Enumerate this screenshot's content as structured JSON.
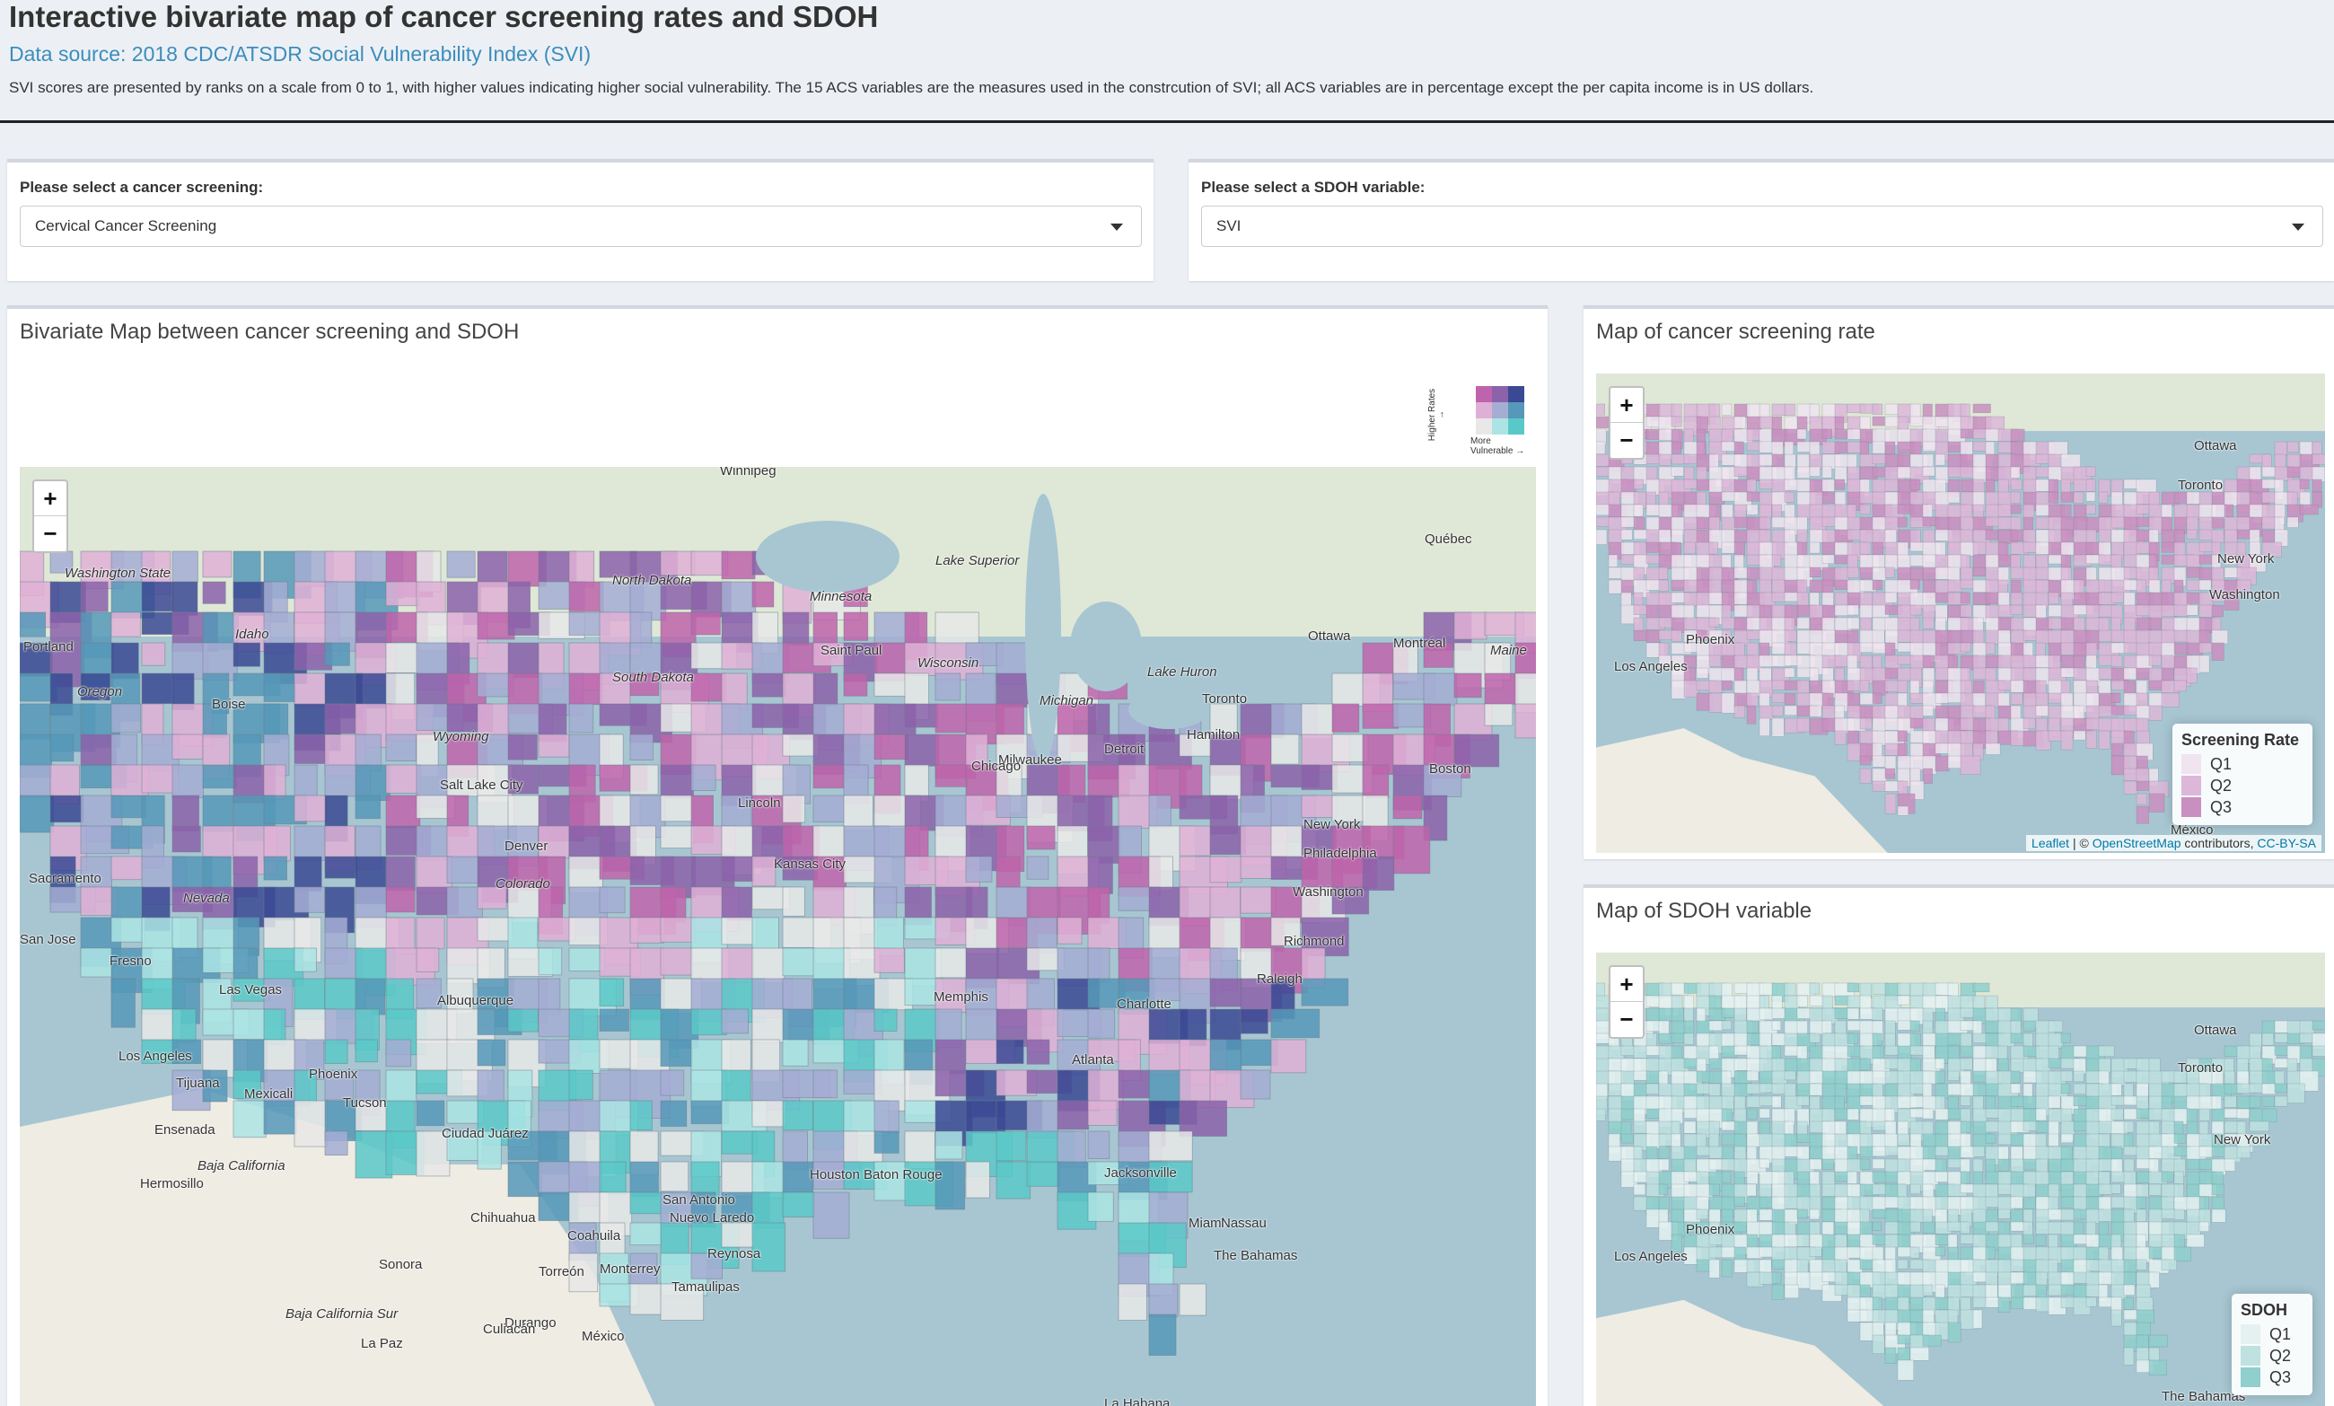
{
  "header": {
    "title": "Interactive bivariate map of cancer screening rates and SDOH",
    "source": "Data source: 2018 CDC/ATSDR Social Vulnerability Index (SVI)",
    "description": "SVI scores are presented by ranks on a scale from 0 to 1, with higher values indicating higher social vulnerability. The 15 ACS variables are the measures used in the constrcution of SVI; all ACS variables are in percentage except the per capita income is in US dollars."
  },
  "controls": {
    "screening_label": "Please select a cancer screening:",
    "screening_value": "Cervical Cancer Screening",
    "sdoh_label": "Please select a SDOH variable:",
    "sdoh_value": "SVI"
  },
  "bivariate": {
    "title": "Bivariate Map between cancer screening and SDOH",
    "legend_y": "Higher Rates →",
    "legend_x": "More Vulnerable →",
    "zoom_in": "+",
    "zoom_out": "−",
    "cities": [
      "Winnipeg",
      "Québec",
      "Ottawa",
      "Montréal",
      "Toronto",
      "Hamilton",
      "Milwaukee",
      "Detroit",
      "Chicago",
      "Boston",
      "New York",
      "Philadelphia",
      "Washington",
      "Richmond",
      "Raleigh",
      "Charlotte",
      "Atlanta",
      "Jacksonville",
      "Miami",
      "Nassau",
      "The Bahamas",
      "La Habana",
      "Houston",
      "San Antonio",
      "Baton Rouge",
      "Memphis",
      "Saint Paul",
      "Lincoln",
      "Kansas City",
      "Denver",
      "Salt Lake City",
      "Sacramento",
      "Fresno",
      "Las Vegas",
      "Los Angeles",
      "Phoenix",
      "Tucson",
      "Tijuana",
      "Mexicali",
      "Ensenada",
      "Ciudad Juárez",
      "Albuquerque",
      "Monterrey",
      "Reynosa",
      "Nuevo Laredo",
      "Torreón",
      "Durango",
      "México",
      "La Paz",
      "Culiacán",
      "Hermosillo",
      "Chihuahua",
      "Sonora",
      "Coahuila",
      "Tamaulipas",
      "Baja California",
      "Baja California Sur",
      "Portland",
      "San Jose",
      "Boise",
      "Wyoming",
      "Idaho",
      "Oregon",
      "Nevada",
      "Colorado",
      "North Dakota",
      "South Dakota",
      "Minnesota",
      "Lake Superior",
      "Lake Huron",
      "Michigan",
      "Wisconsin",
      "Maine",
      "Washington State"
    ]
  },
  "screening_map": {
    "title": "Map of cancer screening rate",
    "legend_title": "Screening Rate",
    "legend_items": [
      "Q1",
      "Q2",
      "Q3"
    ],
    "legend_colors": [
      "#efe4ef",
      "#dcb7d8",
      "#c98fc0"
    ],
    "attribution_leaflet": "Leaflet",
    "attribution_mid": " | © ",
    "attribution_osm": "OpenStreetMap",
    "attribution_contrib": " contributors, ",
    "attribution_license": "CC-BY-SA",
    "cities": [
      "Ottawa",
      "Toronto",
      "New York",
      "Washington",
      "Los Angeles",
      "Phoenix",
      "México"
    ]
  },
  "sdoh_map": {
    "title": "Map of SDOH variable",
    "legend_title": "SDOH",
    "legend_items": [
      "Q1",
      "Q2",
      "Q3"
    ],
    "legend_colors": [
      "#e5f1f1",
      "#bfe1e0",
      "#8fcfcd"
    ],
    "cities": [
      "Ottawa",
      "Toronto",
      "New York",
      "Los Angeles",
      "Phoenix",
      "The Bahamas"
    ]
  },
  "colors": {
    "bivariate_grid": [
      "#e8e8e8",
      "#ace4e4",
      "#5ac8c8",
      "#dfb0d6",
      "#a5add3",
      "#5698b9",
      "#be64ac",
      "#8c62aa",
      "#3b4994"
    ]
  }
}
